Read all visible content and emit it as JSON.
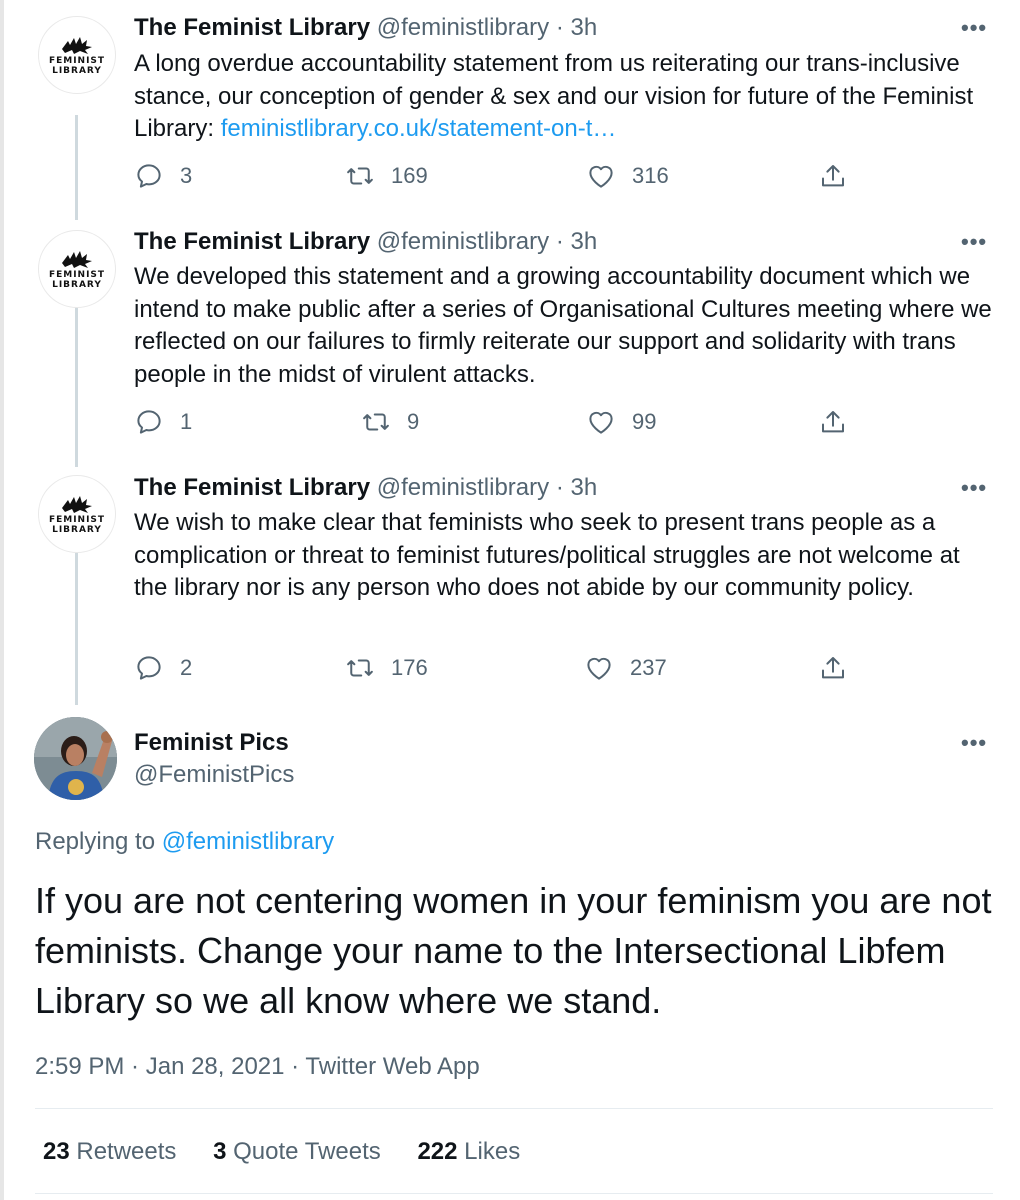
{
  "thread": [
    {
      "name": "The Feminist Library",
      "handle": "@feministlibrary",
      "dot": "·",
      "time": "3h",
      "avatar_text": [
        "FEMINIST",
        "LIBRARY"
      ],
      "text_before_link": "A long overdue accountability statement from us reiterating our trans-inclusive stance, our conception of gender & sex and our vision for future of the Feminist Library: ",
      "link": "feministlibrary.co.uk/statement-on-t…",
      "replies": "3",
      "retweets": "169",
      "likes": "316"
    },
    {
      "name": "The Feminist Library",
      "handle": "@feministlibrary",
      "dot": "·",
      "time": "3h",
      "avatar_text": [
        "FEMINIST",
        "LIBRARY"
      ],
      "text": "We developed this statement and a growing accountability document which we intend to make public after a series of Organisational Cultures meeting where we reflected on our failures to firmly reiterate our support and solidarity with trans people in the midst of virulent attacks.",
      "replies": "1",
      "retweets": "9",
      "likes": "99"
    },
    {
      "name": "The Feminist Library",
      "handle": "@feministlibrary",
      "dot": "·",
      "time": "3h",
      "avatar_text": [
        "FEMINIST",
        "LIBRARY"
      ],
      "text": "We wish to make clear that feminists who seek to present trans people as a complication or threat to feminist futures/political struggles are not welcome at the library nor is any person who does not abide by our community policy.",
      "replies": "2",
      "retweets": "176",
      "likes": "237"
    }
  ],
  "main": {
    "name": "Feminist Pics",
    "handle": "@FeministPics",
    "replying_label": "Replying to ",
    "replying_to": "@feministlibrary",
    "text": "If you are not centering women in your feminism you are not feminists. Change your name to the Intersectional Libfem Library so we all know where we stand.",
    "time": "2:59 PM",
    "date": "Jan 28, 2021",
    "source": "Twitter Web App",
    "sep": " · ",
    "retweets_count": "23",
    "retweets_label": "Retweets",
    "quotes_count": "3",
    "quotes_label": "Quote Tweets",
    "likes_count": "222",
    "likes_label": "Likes"
  },
  "more_glyph": "•••",
  "colors": {
    "text": "#0f1419",
    "secondary": "#536471",
    "link": "#1d9bf0",
    "thread_line": "#cfd9de"
  },
  "icons": [
    "reply-icon",
    "retweet-icon",
    "like-icon",
    "share-icon",
    "more-icon",
    "dragon-logo-icon"
  ]
}
